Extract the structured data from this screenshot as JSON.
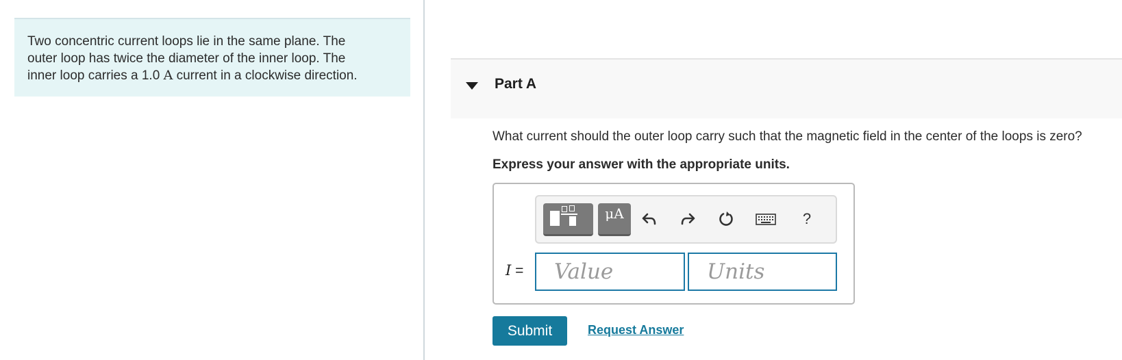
{
  "intro": {
    "line1": "Two concentric current loops lie in the same plane. The",
    "line2": "outer loop has twice the diameter of the inner loop. The",
    "line3_pre": "inner loop carries a 1.0 ",
    "line3_unit": "A",
    "line3_post": " current in a clockwise direction."
  },
  "part": {
    "title": "Part A",
    "question": "What current should the outer loop carry such that the magnetic field in the center of the loops is zero?",
    "instruction": "Express your answer with the appropriate units."
  },
  "toolbar": {
    "units_label": "μA",
    "help_label": "?",
    "icons": [
      "templates-icon",
      "units-icon",
      "undo-icon",
      "redo-icon",
      "reset-icon",
      "keyboard-icon",
      "help-icon"
    ]
  },
  "answer": {
    "variable": "I",
    "equals": " =",
    "value_placeholder": "Value",
    "units_placeholder": "Units"
  },
  "actions": {
    "submit_label": "Submit",
    "request_label": "Request Answer"
  },
  "colors": {
    "accent": "#167a9c",
    "intro_bg": "#e5f5f6",
    "field_border": "#1b78a6"
  }
}
